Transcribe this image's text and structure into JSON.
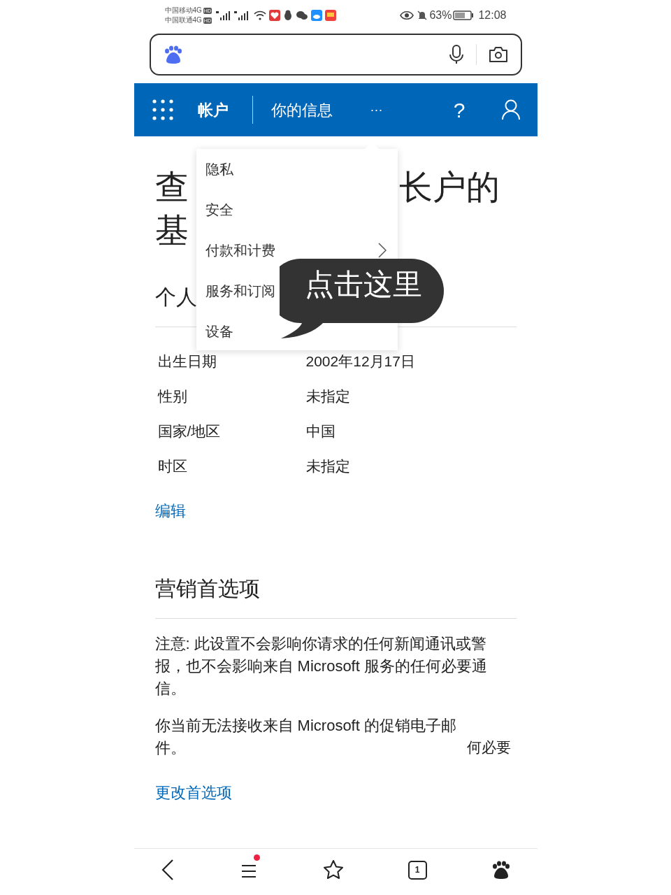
{
  "status_bar": {
    "carriers": [
      {
        "name": "中国移动4G",
        "badge": "HD"
      },
      {
        "name": "中国联通4G",
        "badge": "HD"
      }
    ],
    "battery": "63%",
    "time": "12:08"
  },
  "header": {
    "title": "帐户",
    "subtitle": "你的信息",
    "more": "···",
    "help": "?"
  },
  "heading_fragments": {
    "line1_left": "查",
    "line1_right": "长户的",
    "line2_left": "基"
  },
  "section_title_fragment": "个人",
  "dropdown_menu": [
    {
      "label": "隐私",
      "submenu": false
    },
    {
      "label": "安全",
      "submenu": false
    },
    {
      "label": "付款和计费",
      "submenu": true
    },
    {
      "label": "服务和订阅",
      "submenu": false
    },
    {
      "label": "设备",
      "submenu": false
    }
  ],
  "callout": {
    "text": "点击这里"
  },
  "profile_rows": [
    {
      "label": "出生日期",
      "value": "2002年12月17日"
    },
    {
      "label": "性别",
      "value": "未指定"
    },
    {
      "label": "国家/地区",
      "value": "中国"
    },
    {
      "label": "时区",
      "value": "未指定"
    }
  ],
  "edit_link": "编辑",
  "marketing": {
    "title": "营销首选项",
    "notes": [
      "注意: 此设置不会影响你请求的任何新闻通讯或警报，也不会影响来自 Microsoft 服务的任何必要通信。",
      "你当前无法接收来自 Microsoft 的促销电子邮件。"
    ],
    "stray_text": "何必要",
    "link": "更改首选项"
  },
  "bottom_nav": {
    "tab_count": "1",
    "menu_notification": true
  }
}
